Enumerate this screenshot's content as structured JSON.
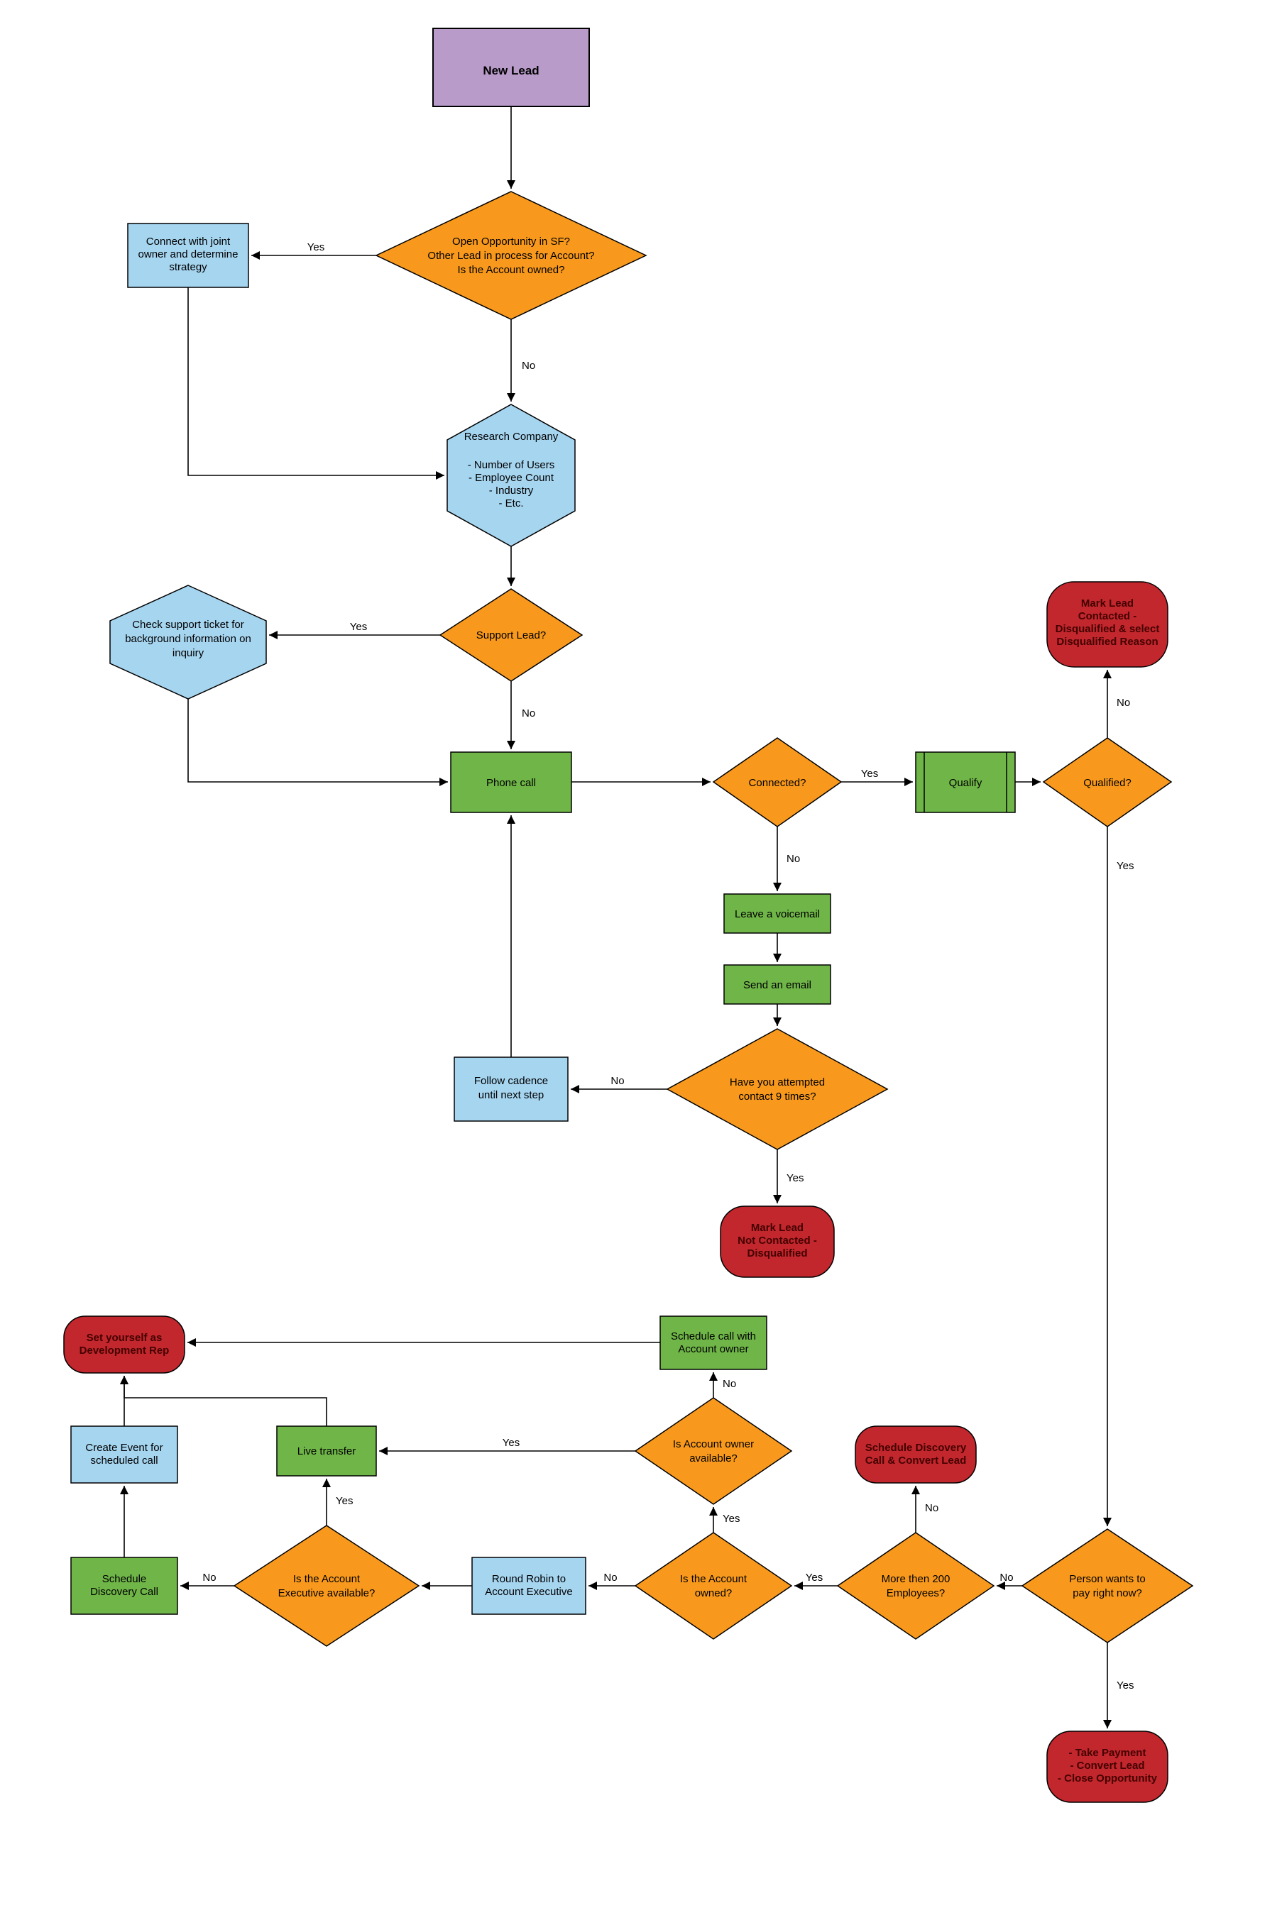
{
  "chart_data": {
    "type": "flowchart",
    "title": "",
    "nodes": [
      {
        "id": "new_lead",
        "type": "start",
        "text": "New Lead"
      },
      {
        "id": "open_opp",
        "type": "decision",
        "text": "Open Opportunity in SF?\nOther Lead in process for Account?\nIs the Account owned?"
      },
      {
        "id": "connect_joint",
        "type": "process",
        "text": "Connect with joint owner and determine strategy"
      },
      {
        "id": "research",
        "type": "prep",
        "text": "Research Company\n\n- Number of Users\n- Employee Count\n- Industry\n- Etc."
      },
      {
        "id": "support_lead",
        "type": "decision",
        "text": "Support Lead?"
      },
      {
        "id": "check_ticket",
        "type": "prep",
        "text": "Check support ticket for background information on inquiry"
      },
      {
        "id": "phone_call",
        "type": "process",
        "text": "Phone call"
      },
      {
        "id": "connected",
        "type": "decision",
        "text": "Connected?"
      },
      {
        "id": "voicemail",
        "type": "process",
        "text": "Leave a voicemail"
      },
      {
        "id": "send_email",
        "type": "process",
        "text": "Send an email"
      },
      {
        "id": "attempt_9",
        "type": "decision",
        "text": "Have you attempted contact 9 times?"
      },
      {
        "id": "follow_cadence",
        "type": "process",
        "text": "Follow cadence until next step"
      },
      {
        "id": "mark_not_contacted",
        "type": "terminator",
        "text": "Mark Lead\nNot Contacted -\nDisqualified"
      },
      {
        "id": "qualify",
        "type": "subprocess",
        "text": "Qualify"
      },
      {
        "id": "qualified",
        "type": "decision",
        "text": "Qualified?"
      },
      {
        "id": "mark_contacted_dq",
        "type": "terminator",
        "text": "Mark Lead\nContacted -\nDisqualified & select\nDisqualified Reason"
      },
      {
        "id": "pay_now",
        "type": "decision",
        "text": "Person wants to pay right now?"
      },
      {
        "id": "take_payment",
        "type": "terminator",
        "text": "- Take Payment\n- Convert Lead\n- Close Opportunity"
      },
      {
        "id": "emp_200",
        "type": "decision",
        "text": "More then 200 Employees?"
      },
      {
        "id": "sched_disc_conv",
        "type": "terminator",
        "text": "Schedule Discovery Call & Convert Lead"
      },
      {
        "id": "acct_owned",
        "type": "decision",
        "text": "Is the Account owned?"
      },
      {
        "id": "owner_avail",
        "type": "decision",
        "text": "Is Account owner available?"
      },
      {
        "id": "sched_call_owner",
        "type": "process",
        "text": "Schedule call with Account owner"
      },
      {
        "id": "round_robin",
        "type": "process",
        "text": "Round Robin to Account Executive"
      },
      {
        "id": "ae_avail",
        "type": "decision",
        "text": "Is the Account Executive available?"
      },
      {
        "id": "live_transfer",
        "type": "process",
        "text": "Live transfer"
      },
      {
        "id": "sched_disc_call",
        "type": "process",
        "text": "Schedule Discovery Call"
      },
      {
        "id": "create_event",
        "type": "process",
        "text": "Create Event for scheduled call"
      },
      {
        "id": "set_dev_rep",
        "type": "terminator",
        "text": "Set yourself as Development Rep"
      }
    ],
    "edges": [
      {
        "from": "new_lead",
        "to": "open_opp",
        "label": ""
      },
      {
        "from": "open_opp",
        "to": "connect_joint",
        "label": "Yes"
      },
      {
        "from": "open_opp",
        "to": "research",
        "label": "No"
      },
      {
        "from": "connect_joint",
        "to": "research",
        "label": ""
      },
      {
        "from": "research",
        "to": "support_lead",
        "label": ""
      },
      {
        "from": "support_lead",
        "to": "check_ticket",
        "label": "Yes"
      },
      {
        "from": "support_lead",
        "to": "phone_call",
        "label": "No"
      },
      {
        "from": "check_ticket",
        "to": "phone_call",
        "label": ""
      },
      {
        "from": "phone_call",
        "to": "connected",
        "label": ""
      },
      {
        "from": "connected",
        "to": "qualify",
        "label": "Yes"
      },
      {
        "from": "connected",
        "to": "voicemail",
        "label": "No"
      },
      {
        "from": "voicemail",
        "to": "send_email",
        "label": ""
      },
      {
        "from": "send_email",
        "to": "attempt_9",
        "label": ""
      },
      {
        "from": "attempt_9",
        "to": "follow_cadence",
        "label": "No"
      },
      {
        "from": "attempt_9",
        "to": "mark_not_contacted",
        "label": "Yes"
      },
      {
        "from": "follow_cadence",
        "to": "phone_call",
        "label": ""
      },
      {
        "from": "qualify",
        "to": "qualified",
        "label": ""
      },
      {
        "from": "qualified",
        "to": "mark_contacted_dq",
        "label": "No"
      },
      {
        "from": "qualified",
        "to": "pay_now",
        "label": "Yes"
      },
      {
        "from": "pay_now",
        "to": "take_payment",
        "label": "Yes"
      },
      {
        "from": "pay_now",
        "to": "emp_200",
        "label": "No"
      },
      {
        "from": "emp_200",
        "to": "sched_disc_conv",
        "label": "No"
      },
      {
        "from": "emp_200",
        "to": "acct_owned",
        "label": "Yes"
      },
      {
        "from": "acct_owned",
        "to": "owner_avail",
        "label": "Yes"
      },
      {
        "from": "acct_owned",
        "to": "round_robin",
        "label": "No"
      },
      {
        "from": "owner_avail",
        "to": "live_transfer",
        "label": "Yes"
      },
      {
        "from": "owner_avail",
        "to": "sched_call_owner",
        "label": "No"
      },
      {
        "from": "sched_call_owner",
        "to": "set_dev_rep",
        "label": ""
      },
      {
        "from": "round_robin",
        "to": "ae_avail",
        "label": ""
      },
      {
        "from": "ae_avail",
        "to": "live_transfer",
        "label": "Yes"
      },
      {
        "from": "ae_avail",
        "to": "sched_disc_call",
        "label": "No"
      },
      {
        "from": "live_transfer",
        "to": "set_dev_rep",
        "label": ""
      },
      {
        "from": "sched_disc_call",
        "to": "create_event",
        "label": ""
      },
      {
        "from": "create_event",
        "to": "set_dev_rep",
        "label": ""
      }
    ]
  },
  "nodes": {
    "new_lead": "New Lead",
    "open_opp_l1": "Open Opportunity in SF?",
    "open_opp_l2": "Other Lead in process for Account?",
    "open_opp_l3": "Is the Account owned?",
    "connect_joint_l1": "Connect with joint",
    "connect_joint_l2": "owner and determine",
    "connect_joint_l3": "strategy",
    "research_l1": "Research Company",
    "research_l2": "- Number of Users",
    "research_l3": "- Employee Count",
    "research_l4": "- Industry",
    "research_l5": "- Etc.",
    "support_lead": "Support Lead?",
    "check_ticket_l1": "Check support ticket for",
    "check_ticket_l2": "background information on",
    "check_ticket_l3": "inquiry",
    "phone_call": "Phone call",
    "connected": "Connected?",
    "voicemail": "Leave a voicemail",
    "send_email": "Send an email",
    "attempt_9_l1": "Have you attempted",
    "attempt_9_l2": "contact 9 times?",
    "follow_cadence_l1": "Follow cadence",
    "follow_cadence_l2": "until next step",
    "mark_nc_l1": "Mark Lead",
    "mark_nc_l2": "Not Contacted -",
    "mark_nc_l3": "Disqualified",
    "qualify": "Qualify",
    "qualified": "Qualified?",
    "mark_c_l1": "Mark Lead",
    "mark_c_l2": "Contacted -",
    "mark_c_l3": "Disqualified & select",
    "mark_c_l4": "Disqualified Reason",
    "pay_now_l1": "Person wants to",
    "pay_now_l2": "pay right now?",
    "take_pay_l1": "- Take Payment",
    "take_pay_l2": "- Convert Lead",
    "take_pay_l3": "- Close Opportunity",
    "emp_200_l1": "More then 200",
    "emp_200_l2": "Employees?",
    "sched_dc_conv_l1": "Schedule Discovery",
    "sched_dc_conv_l2": "Call & Convert Lead",
    "acct_owned_l1": "Is the Account",
    "acct_owned_l2": "owned?",
    "owner_avail_l1": "Is Account owner",
    "owner_avail_l2": "available?",
    "sched_owner_l1": "Schedule call with",
    "sched_owner_l2": "Account owner",
    "round_robin_l1": "Round Robin to",
    "round_robin_l2": "Account Executive",
    "ae_avail_l1": "Is the Account",
    "ae_avail_l2": "Executive available?",
    "live_transfer": "Live transfer",
    "sched_disc_l1": "Schedule",
    "sched_disc_l2": "Discovery Call",
    "create_event_l1": "Create Event for",
    "create_event_l2": "scheduled call",
    "set_dev_l1": "Set yourself as",
    "set_dev_l2": "Development Rep"
  },
  "labels": {
    "yes": "Yes",
    "no": "No"
  },
  "colors": {
    "purple": "#b89bc9",
    "orange": "#f8991d",
    "blue": "#a6d5f0",
    "green": "#6fb548",
    "red": "#c1272d",
    "stroke": "#000000"
  }
}
